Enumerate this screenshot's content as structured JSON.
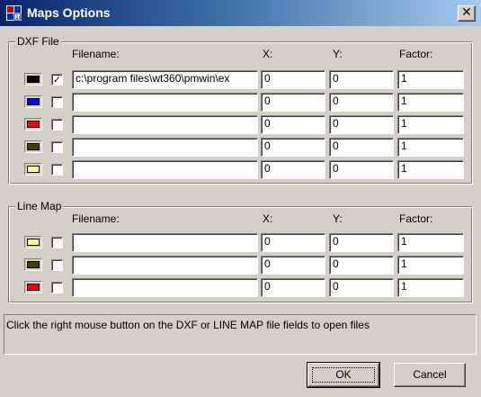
{
  "window": {
    "title": "Maps Options",
    "close_glyph": "✕",
    "app_icon": "map-app-icon"
  },
  "dxf": {
    "label": "DXF File",
    "headers": {
      "filename": "Filename:",
      "x": "X:",
      "y": "Y:",
      "factor": "Factor:"
    },
    "rows": [
      {
        "color": "#000000",
        "checked": true,
        "check_glyph": "✓",
        "filename": "c:\\program files\\wt360\\pmwin\\ex",
        "x": "0",
        "y": "0",
        "factor": "1"
      },
      {
        "color": "#0000ff",
        "checked": false,
        "check_glyph": "",
        "filename": "",
        "x": "0",
        "y": "0",
        "factor": "1"
      },
      {
        "color": "#ff0000",
        "checked": false,
        "check_glyph": "",
        "filename": "",
        "x": "0",
        "y": "0",
        "factor": "1"
      },
      {
        "color": "#404000",
        "checked": false,
        "check_glyph": "",
        "filename": "",
        "x": "0",
        "y": "0",
        "factor": "1"
      },
      {
        "color": "#ffff80",
        "checked": false,
        "check_glyph": "",
        "filename": "",
        "x": "0",
        "y": "0",
        "factor": "1"
      }
    ]
  },
  "linemap": {
    "label": "Line Map",
    "headers": {
      "filename": "Filename:",
      "x": "X:",
      "y": "Y:",
      "factor": "Factor:"
    },
    "rows": [
      {
        "color": "#ffff80",
        "checked": false,
        "check_glyph": "",
        "filename": "",
        "x": "0",
        "y": "0",
        "factor": "1"
      },
      {
        "color": "#404000",
        "checked": false,
        "check_glyph": "",
        "filename": "",
        "x": "0",
        "y": "0",
        "factor": "1"
      },
      {
        "color": "#ff0000",
        "checked": false,
        "check_glyph": "",
        "filename": "",
        "x": "0",
        "y": "0",
        "factor": "1"
      }
    ]
  },
  "hint": "Click the right mouse button on the DXF or LINE MAP file fields to open files",
  "buttons": {
    "ok": "OK",
    "cancel": "Cancel"
  }
}
